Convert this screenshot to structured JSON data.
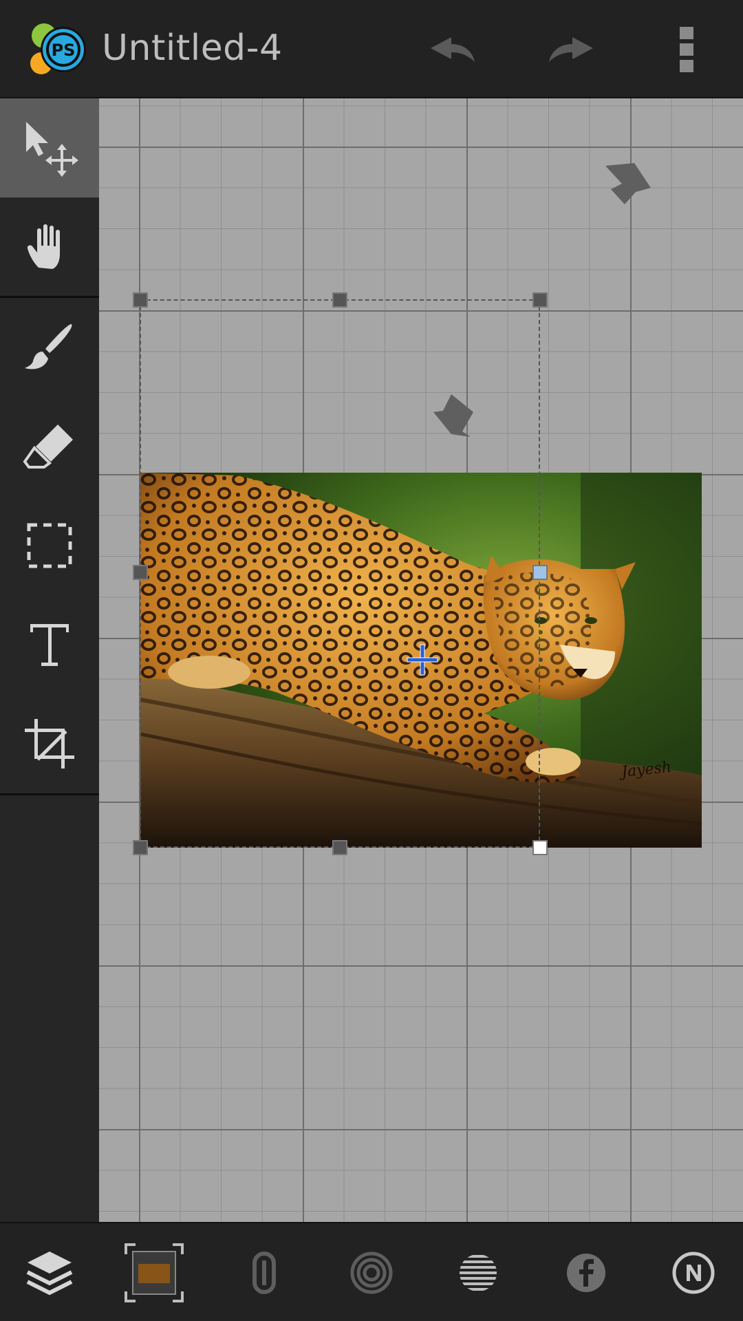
{
  "header": {
    "document_title": "Untitled-4",
    "logo_icon": "ps-express-logo-icon",
    "undo_icon": "undo-icon",
    "redo_icon": "redo-icon",
    "overflow_icon": "overflow-menu-icon"
  },
  "toolbar": {
    "tools": [
      {
        "id": "move",
        "icon": "move-select-icon",
        "active": true
      },
      {
        "id": "pan",
        "icon": "hand-icon",
        "active": false
      },
      {
        "id": "brush",
        "icon": "brush-icon",
        "active": false
      },
      {
        "id": "eraser",
        "icon": "eraser-icon",
        "active": false
      },
      {
        "id": "marquee",
        "icon": "marquee-select-icon",
        "active": false
      },
      {
        "id": "text",
        "icon": "text-tool-icon",
        "active": false
      },
      {
        "id": "crop",
        "icon": "crop-icon",
        "active": false
      }
    ]
  },
  "canvas": {
    "layer_image": "jaguar-on-log photo",
    "photo_signature": "Jayesh"
  },
  "bottombar": {
    "buttons": [
      {
        "id": "layers",
        "icon": "layers-icon"
      },
      {
        "id": "layer-thumbnail",
        "icon": "layer-thumbnail-icon"
      },
      {
        "id": "link",
        "icon": "link-icon"
      },
      {
        "id": "blend",
        "icon": "blend-circle-icon"
      },
      {
        "id": "opacity",
        "icon": "opacity-stripes-icon"
      },
      {
        "id": "facebook",
        "icon": "facebook-icon"
      },
      {
        "id": "new",
        "icon": "n-circle-icon"
      }
    ]
  },
  "colors": {
    "bar_bg": "#222222",
    "toolbar_bg": "#262626",
    "active_tool": "#5c5c5c",
    "canvas_bg": "#a6a6a6",
    "icon_color": "#d6d6d6",
    "logo_blue": "#29a9df"
  }
}
